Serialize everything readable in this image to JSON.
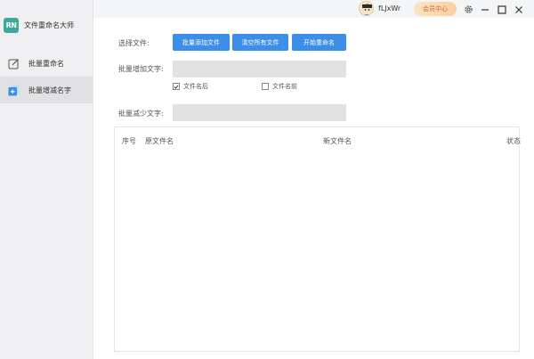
{
  "app": {
    "logo_text": "RN",
    "title": "文件重命名大师"
  },
  "sidebar": {
    "items": [
      {
        "label": "批量重命名",
        "icon": "edit-icon",
        "active": false
      },
      {
        "label": "批量增减名字",
        "icon": "plus-square-icon",
        "active": true
      }
    ]
  },
  "header": {
    "username": "fLJxWr",
    "vip_label": "会员中心",
    "icons": [
      "avatar",
      "gear-icon",
      "minimize-icon",
      "maximize-icon",
      "close-icon"
    ]
  },
  "form": {
    "select_label": "选择文件:",
    "buttons": {
      "add_files": "批量添加文件",
      "clear_files": "清空所有文件",
      "start_rename": "开始重命名"
    },
    "add_text_label": "批量增加文字:",
    "add_text_value": "",
    "options": [
      {
        "label": "文件名后",
        "checked": true
      },
      {
        "label": "文件名前",
        "checked": false
      }
    ],
    "remove_text_label": "批量减少文字:",
    "remove_text_value": ""
  },
  "table": {
    "columns": {
      "index": "序号",
      "original": "原文件名",
      "new": "新文件名",
      "status": "状态"
    },
    "rows": []
  },
  "colors": {
    "accent": "#3d8ee6",
    "logo": "#3ea89a",
    "vip_text": "#d4682b"
  }
}
